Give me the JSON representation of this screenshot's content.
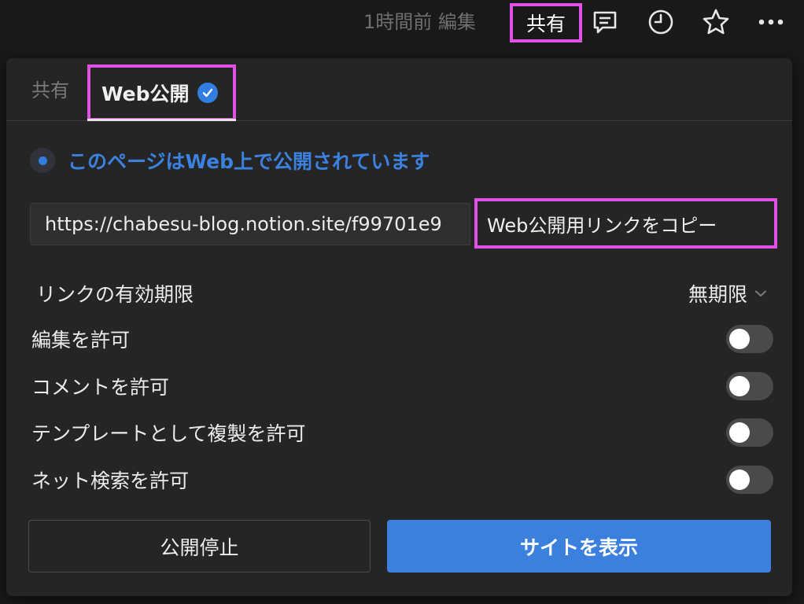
{
  "topbar": {
    "edited_text": "1時間前 編集",
    "share_label": "共有",
    "icons": [
      "comment-icon",
      "clock-icon",
      "star-icon",
      "more-icon"
    ]
  },
  "tabs": {
    "share_label": "共有",
    "web_label": "Web公開"
  },
  "status": {
    "text": "このページはWeb上で公開されています"
  },
  "link": {
    "url": "https://chabesu-blog.notion.site/f99701e9",
    "copy_label": "Web公開用リンクをコピー"
  },
  "settings": {
    "expiry_label": "リンクの有効期限",
    "expiry_value": "無期限",
    "toggles": [
      {
        "label": "編集を許可",
        "on": false
      },
      {
        "label": "コメントを許可",
        "on": false
      },
      {
        "label": "テンプレートとして複製を許可",
        "on": false
      },
      {
        "label": "ネット検索を許可",
        "on": false
      }
    ]
  },
  "buttons": {
    "stop_label": "公開停止",
    "view_site_label": "サイトを表示"
  },
  "colors": {
    "accent": "#2f7ee0",
    "highlight": "#e251e5",
    "panel_bg": "#252525"
  }
}
